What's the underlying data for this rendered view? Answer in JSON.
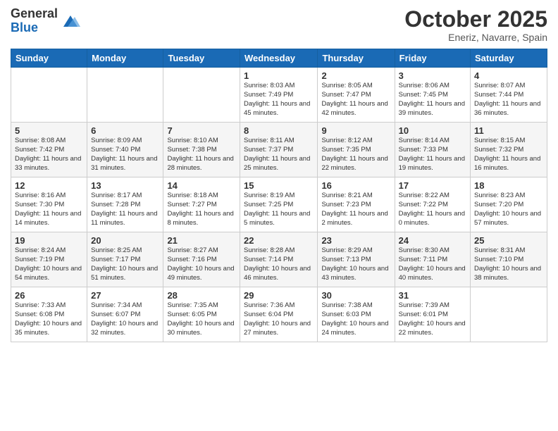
{
  "logo": {
    "general": "General",
    "blue": "Blue"
  },
  "header": {
    "month": "October 2025",
    "location": "Eneriz, Navarre, Spain"
  },
  "days_of_week": [
    "Sunday",
    "Monday",
    "Tuesday",
    "Wednesday",
    "Thursday",
    "Friday",
    "Saturday"
  ],
  "weeks": [
    [
      {
        "num": "",
        "sunrise": "",
        "sunset": "",
        "daylight": ""
      },
      {
        "num": "",
        "sunrise": "",
        "sunset": "",
        "daylight": ""
      },
      {
        "num": "",
        "sunrise": "",
        "sunset": "",
        "daylight": ""
      },
      {
        "num": "1",
        "sunrise": "Sunrise: 8:03 AM",
        "sunset": "Sunset: 7:49 PM",
        "daylight": "Daylight: 11 hours and 45 minutes."
      },
      {
        "num": "2",
        "sunrise": "Sunrise: 8:05 AM",
        "sunset": "Sunset: 7:47 PM",
        "daylight": "Daylight: 11 hours and 42 minutes."
      },
      {
        "num": "3",
        "sunrise": "Sunrise: 8:06 AM",
        "sunset": "Sunset: 7:45 PM",
        "daylight": "Daylight: 11 hours and 39 minutes."
      },
      {
        "num": "4",
        "sunrise": "Sunrise: 8:07 AM",
        "sunset": "Sunset: 7:44 PM",
        "daylight": "Daylight: 11 hours and 36 minutes."
      }
    ],
    [
      {
        "num": "5",
        "sunrise": "Sunrise: 8:08 AM",
        "sunset": "Sunset: 7:42 PM",
        "daylight": "Daylight: 11 hours and 33 minutes."
      },
      {
        "num": "6",
        "sunrise": "Sunrise: 8:09 AM",
        "sunset": "Sunset: 7:40 PM",
        "daylight": "Daylight: 11 hours and 31 minutes."
      },
      {
        "num": "7",
        "sunrise": "Sunrise: 8:10 AM",
        "sunset": "Sunset: 7:38 PM",
        "daylight": "Daylight: 11 hours and 28 minutes."
      },
      {
        "num": "8",
        "sunrise": "Sunrise: 8:11 AM",
        "sunset": "Sunset: 7:37 PM",
        "daylight": "Daylight: 11 hours and 25 minutes."
      },
      {
        "num": "9",
        "sunrise": "Sunrise: 8:12 AM",
        "sunset": "Sunset: 7:35 PM",
        "daylight": "Daylight: 11 hours and 22 minutes."
      },
      {
        "num": "10",
        "sunrise": "Sunrise: 8:14 AM",
        "sunset": "Sunset: 7:33 PM",
        "daylight": "Daylight: 11 hours and 19 minutes."
      },
      {
        "num": "11",
        "sunrise": "Sunrise: 8:15 AM",
        "sunset": "Sunset: 7:32 PM",
        "daylight": "Daylight: 11 hours and 16 minutes."
      }
    ],
    [
      {
        "num": "12",
        "sunrise": "Sunrise: 8:16 AM",
        "sunset": "Sunset: 7:30 PM",
        "daylight": "Daylight: 11 hours and 14 minutes."
      },
      {
        "num": "13",
        "sunrise": "Sunrise: 8:17 AM",
        "sunset": "Sunset: 7:28 PM",
        "daylight": "Daylight: 11 hours and 11 minutes."
      },
      {
        "num": "14",
        "sunrise": "Sunrise: 8:18 AM",
        "sunset": "Sunset: 7:27 PM",
        "daylight": "Daylight: 11 hours and 8 minutes."
      },
      {
        "num": "15",
        "sunrise": "Sunrise: 8:19 AM",
        "sunset": "Sunset: 7:25 PM",
        "daylight": "Daylight: 11 hours and 5 minutes."
      },
      {
        "num": "16",
        "sunrise": "Sunrise: 8:21 AM",
        "sunset": "Sunset: 7:23 PM",
        "daylight": "Daylight: 11 hours and 2 minutes."
      },
      {
        "num": "17",
        "sunrise": "Sunrise: 8:22 AM",
        "sunset": "Sunset: 7:22 PM",
        "daylight": "Daylight: 11 hours and 0 minutes."
      },
      {
        "num": "18",
        "sunrise": "Sunrise: 8:23 AM",
        "sunset": "Sunset: 7:20 PM",
        "daylight": "Daylight: 10 hours and 57 minutes."
      }
    ],
    [
      {
        "num": "19",
        "sunrise": "Sunrise: 8:24 AM",
        "sunset": "Sunset: 7:19 PM",
        "daylight": "Daylight: 10 hours and 54 minutes."
      },
      {
        "num": "20",
        "sunrise": "Sunrise: 8:25 AM",
        "sunset": "Sunset: 7:17 PM",
        "daylight": "Daylight: 10 hours and 51 minutes."
      },
      {
        "num": "21",
        "sunrise": "Sunrise: 8:27 AM",
        "sunset": "Sunset: 7:16 PM",
        "daylight": "Daylight: 10 hours and 49 minutes."
      },
      {
        "num": "22",
        "sunrise": "Sunrise: 8:28 AM",
        "sunset": "Sunset: 7:14 PM",
        "daylight": "Daylight: 10 hours and 46 minutes."
      },
      {
        "num": "23",
        "sunrise": "Sunrise: 8:29 AM",
        "sunset": "Sunset: 7:13 PM",
        "daylight": "Daylight: 10 hours and 43 minutes."
      },
      {
        "num": "24",
        "sunrise": "Sunrise: 8:30 AM",
        "sunset": "Sunset: 7:11 PM",
        "daylight": "Daylight: 10 hours and 40 minutes."
      },
      {
        "num": "25",
        "sunrise": "Sunrise: 8:31 AM",
        "sunset": "Sunset: 7:10 PM",
        "daylight": "Daylight: 10 hours and 38 minutes."
      }
    ],
    [
      {
        "num": "26",
        "sunrise": "Sunrise: 7:33 AM",
        "sunset": "Sunset: 6:08 PM",
        "daylight": "Daylight: 10 hours and 35 minutes."
      },
      {
        "num": "27",
        "sunrise": "Sunrise: 7:34 AM",
        "sunset": "Sunset: 6:07 PM",
        "daylight": "Daylight: 10 hours and 32 minutes."
      },
      {
        "num": "28",
        "sunrise": "Sunrise: 7:35 AM",
        "sunset": "Sunset: 6:05 PM",
        "daylight": "Daylight: 10 hours and 30 minutes."
      },
      {
        "num": "29",
        "sunrise": "Sunrise: 7:36 AM",
        "sunset": "Sunset: 6:04 PM",
        "daylight": "Daylight: 10 hours and 27 minutes."
      },
      {
        "num": "30",
        "sunrise": "Sunrise: 7:38 AM",
        "sunset": "Sunset: 6:03 PM",
        "daylight": "Daylight: 10 hours and 24 minutes."
      },
      {
        "num": "31",
        "sunrise": "Sunrise: 7:39 AM",
        "sunset": "Sunset: 6:01 PM",
        "daylight": "Daylight: 10 hours and 22 minutes."
      },
      {
        "num": "",
        "sunrise": "",
        "sunset": "",
        "daylight": ""
      }
    ]
  ]
}
